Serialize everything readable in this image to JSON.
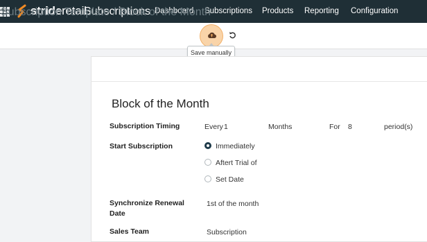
{
  "nav": {
    "brand_bold": "stride",
    "brand_light": "retail",
    "app_name": "Subscriptions",
    "menu": [
      "Dashboard",
      "Subscriptions",
      "Products",
      "Reporting",
      "Configuration"
    ]
  },
  "breadcrumb": {
    "parent": "Subscription Template",
    "separator": "/",
    "current": "Block of the Month"
  },
  "tooltip": "Save manually",
  "form": {
    "title": "Block of the Month",
    "timing": {
      "label": "Subscription Timing",
      "every": "Every",
      "interval": "1",
      "unit": "Months",
      "for": "For",
      "count": "8",
      "suffix": "period(s)"
    },
    "start": {
      "label": "Start Subscription",
      "options": [
        "Immediately",
        "Aftert Trial of",
        "Set Date"
      ],
      "selected_index": 0
    },
    "sync": {
      "label_line1": "Synchronize Renewal",
      "label_line2": "Date",
      "value": "1st of the month"
    },
    "team": {
      "label": "Sales Team",
      "value": "Subscription"
    }
  },
  "colors": {
    "navbar": "#1f2f36",
    "accent": "#f4b062",
    "brand_orange": "#f08a24"
  }
}
